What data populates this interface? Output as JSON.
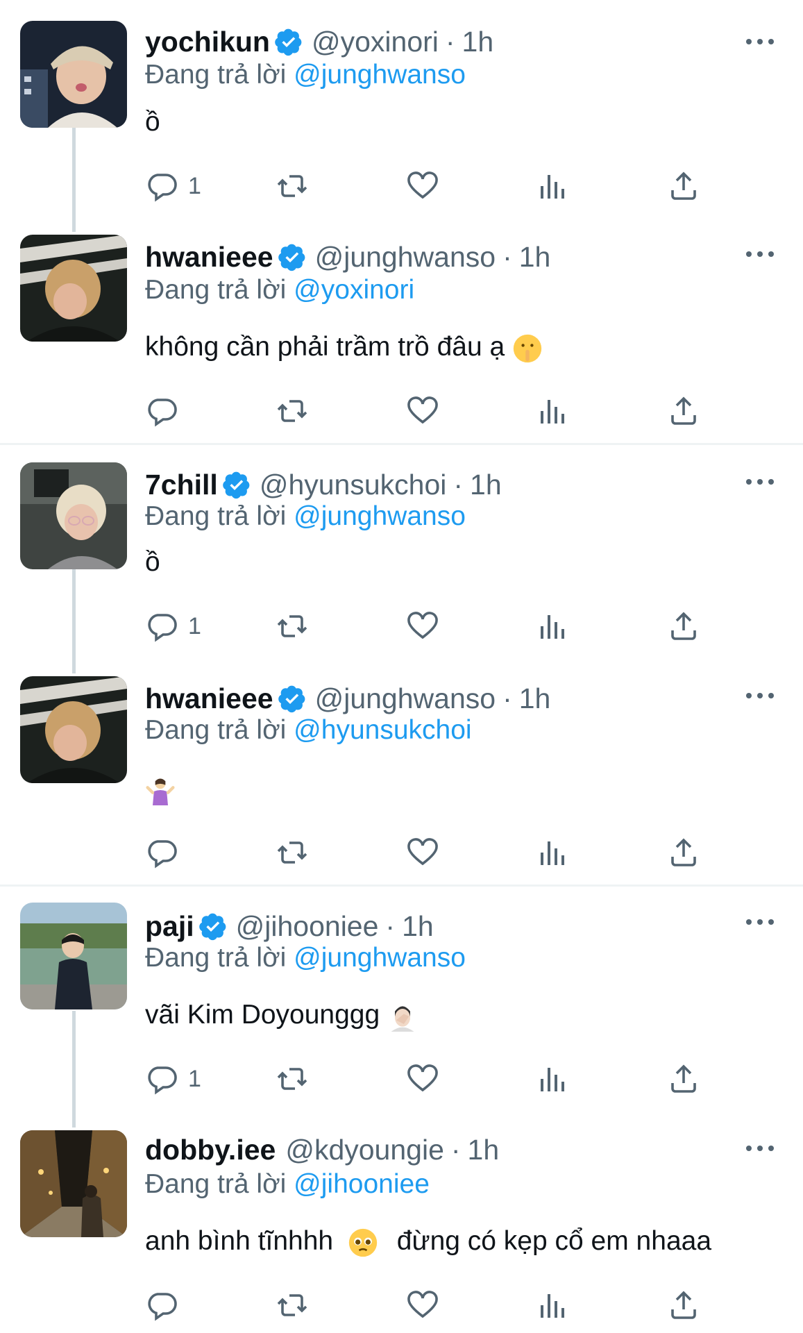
{
  "tweets": [
    {
      "name": "yochikun",
      "handle": "@yoxinori",
      "dot": "·",
      "time": "1h",
      "reply_prefix": "Đang trả lời",
      "reply_mention": "@junghwanso",
      "text": "ồ",
      "reply_count": "1"
    },
    {
      "name": "hwanieee",
      "handle": "@junghwanso",
      "dot": "·",
      "time": "1h",
      "reply_prefix": "Đang trả lời",
      "reply_mention": "@yoxinori",
      "text": "không cần phải trầm trồ đâu ạ",
      "reply_count": ""
    },
    {
      "name": "7chill",
      "handle": "@hyunsukchoi",
      "dot": "·",
      "time": "1h",
      "reply_prefix": "Đang trả lời",
      "reply_mention": "@junghwanso",
      "text": "ồ",
      "reply_count": "1"
    },
    {
      "name": "hwanieee",
      "handle": "@junghwanso",
      "dot": "·",
      "time": "1h",
      "reply_prefix": "Đang trả lời",
      "reply_mention": "@hyunsukchoi",
      "text": "",
      "reply_count": ""
    },
    {
      "name": "paji",
      "handle": "@jihooniee",
      "dot": "·",
      "time": "1h",
      "reply_prefix": "Đang trả lời",
      "reply_mention": "@junghwanso",
      "text": "vãi Kim Doyounggg",
      "reply_count": "1"
    },
    {
      "name": "dobby.iee",
      "handle": "@kdyoungie",
      "dot": "·",
      "time": "1h",
      "reply_prefix": "Đang trả lời",
      "reply_mention": "@jihooniee",
      "text_a": "anh bình tĩnhhh",
      "text_b": "đừng có kẹp cổ em nhaaa",
      "reply_count": ""
    }
  ],
  "colors": {
    "accent": "#1d9bf0",
    "secondary_text": "#536471",
    "primary_text": "#0f1419",
    "divider": "#eff3f4",
    "thread_line": "#cfd9de"
  },
  "icons": {
    "verified": "verified-badge-icon",
    "reply": "reply-icon",
    "retweet": "retweet-icon",
    "like": "heart-icon",
    "views": "views-icon",
    "share": "share-icon",
    "more": "more-icon"
  }
}
